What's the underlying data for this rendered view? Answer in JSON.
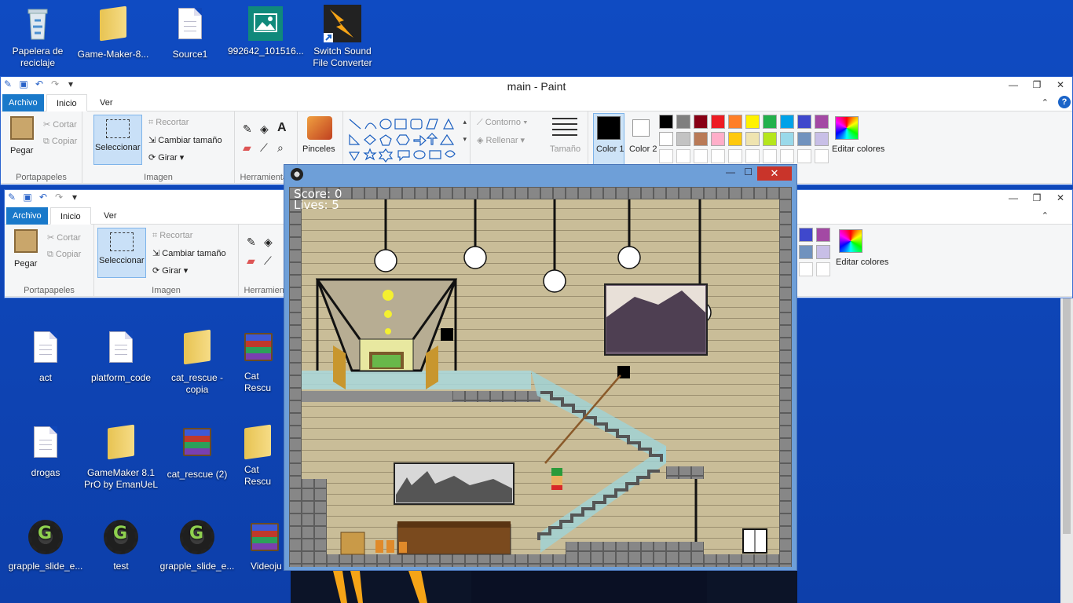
{
  "desktop_top": [
    {
      "label": "Papelera de reciclaje",
      "icon": "recycle-bin-icon"
    },
    {
      "label": "Game-Maker-8...",
      "icon": "folder-icon"
    },
    {
      "label": "Source1",
      "icon": "document-icon"
    },
    {
      "label": "992642_101516...",
      "icon": "image-icon"
    },
    {
      "label": "Switch Sound File Converter",
      "icon": "sound-converter-icon"
    }
  ],
  "desktop_grid": [
    {
      "label": "act",
      "icon": "document-icon"
    },
    {
      "label": "platform_code",
      "icon": "document-icon"
    },
    {
      "label": "cat_rescue - copia",
      "icon": "folder-icon"
    },
    {
      "label": "Cat Rescu",
      "icon": "winrar-icon"
    },
    {
      "label": "drogas",
      "icon": "document-icon"
    },
    {
      "label": "GameMaker 8.1 PrO by EmanUeL",
      "icon": "folder-icon"
    },
    {
      "label": "cat_rescue (2)",
      "icon": "winrar-icon"
    },
    {
      "label": "Cat Rescu",
      "icon": "folder-icon"
    },
    {
      "label": "grapple_slide_e...",
      "icon": "gamemaker-icon"
    },
    {
      "label": "test",
      "icon": "gamemaker-icon"
    },
    {
      "label": "grapple_slide_e...",
      "icon": "gamemaker-icon"
    },
    {
      "label": "Videoju",
      "icon": "winrar-icon"
    }
  ],
  "paint": {
    "title": "main - Paint",
    "tabs": [
      "Archivo",
      "Inicio",
      "Ver"
    ],
    "clipboard": {
      "paste": "Pegar",
      "cut": "Cortar",
      "copy": "Copiar",
      "group": "Portapapeles"
    },
    "image": {
      "select": "Seleccionar",
      "crop": "Recortar",
      "resize": "Cambiar tamaño",
      "rotate": "Girar",
      "group": "Imagen"
    },
    "tools_group": "Herramientas",
    "brushes": "Pinceles",
    "outline": "Contorno",
    "fill": "Rellenar",
    "size": "Tamaño",
    "color1": "Color 1",
    "color2": "Color 2",
    "edit_colors": "Editar colores",
    "palette_row1": [
      "#000000",
      "#7f7f7f",
      "#880015",
      "#ed1c24",
      "#ff7f27",
      "#fff200",
      "#22b14c",
      "#00a2e8",
      "#3f48cc",
      "#a349a4"
    ],
    "palette_row2": [
      "#ffffff",
      "#c3c3c3",
      "#b97a57",
      "#ffaec9",
      "#ffc90e",
      "#efe4b0",
      "#b5e61d",
      "#99d9ea",
      "#7092be",
      "#c8bfe7"
    ]
  },
  "game": {
    "score_label": "Score: 0",
    "lives_label": "Lives: 5"
  }
}
